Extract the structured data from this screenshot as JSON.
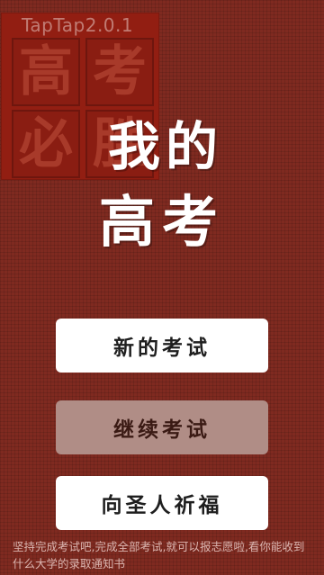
{
  "app": {
    "version": "TapTap2.0.1"
  },
  "seal": {
    "chars": [
      "高",
      "考",
      "必",
      "胜"
    ]
  },
  "title": {
    "line1": "我的",
    "line2": "高考"
  },
  "menu": {
    "new_exam": "新的考试",
    "continue_exam": "继续考试",
    "pray": "向圣人祈福"
  },
  "footer": {
    "text": "坚持完成考试吧,完成全部考试,就可以报志愿啦,看你能收到什么大学的录取通知书"
  },
  "colors": {
    "background": "#7f2a20",
    "seal": "#921e12",
    "button": "#ffffff",
    "button_disabled": "#b08d86"
  }
}
